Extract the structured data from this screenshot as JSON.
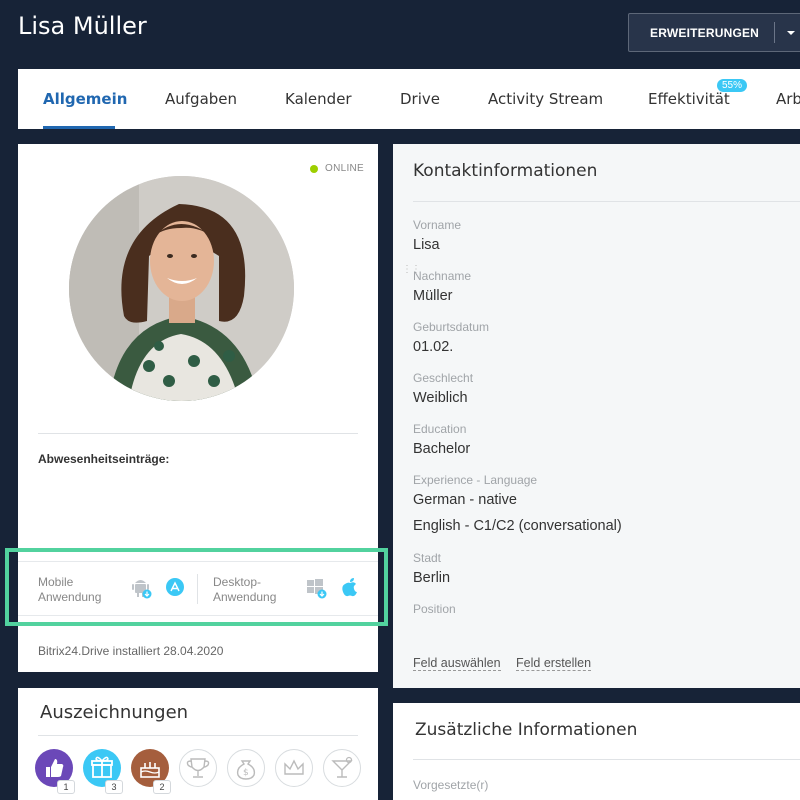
{
  "header": {
    "title": "Lisa Müller",
    "extensions_label": "ERWEITERUNGEN"
  },
  "tabs": [
    {
      "label": "Allgemein",
      "active": true
    },
    {
      "label": "Aufgaben"
    },
    {
      "label": "Kalender"
    },
    {
      "label": "Drive"
    },
    {
      "label": "Activity Stream"
    },
    {
      "label": "Effektivität",
      "badge": "55%"
    },
    {
      "label": "Arb"
    }
  ],
  "profile": {
    "status": "ONLINE",
    "absence_label": "Abwesenheitseinträge:",
    "apps": {
      "mobile_label_1": "Mobile",
      "mobile_label_2": "Anwendung",
      "desktop_label_1": "Desktop-",
      "desktop_label_2": "Anwendung",
      "icons": [
        "android-icon",
        "app-store-icon",
        "windows-icon",
        "apple-icon"
      ]
    },
    "drive_status": "Bitrix24.Drive installiert 28.04.2020"
  },
  "awards": {
    "title": "Auszeichnungen",
    "items": [
      {
        "icon": "thumbs-up-icon",
        "color": "#6b48b8",
        "count": "1"
      },
      {
        "icon": "gift-icon",
        "color": "#3bc8f5",
        "count": "3"
      },
      {
        "icon": "cake-icon",
        "color": "#a55e3d",
        "count": "2"
      },
      {
        "icon": "trophy-icon"
      },
      {
        "icon": "money-bag-icon"
      },
      {
        "icon": "crown-icon"
      },
      {
        "icon": "cocktail-icon"
      }
    ]
  },
  "contact": {
    "title": "Kontaktinformationen",
    "fields": [
      {
        "label": "Vorname",
        "value": "Lisa"
      },
      {
        "label": "Nachname",
        "value": "Müller"
      },
      {
        "label": "Geburtsdatum",
        "value": "01.02."
      },
      {
        "label": "Geschlecht",
        "value": "Weiblich"
      },
      {
        "label": "Education",
        "value": "Bachelor"
      },
      {
        "label": "Experience - Language",
        "value": "German - native",
        "value2": "English - C1/C2 (conversational)"
      },
      {
        "label": "Stadt",
        "value": "Berlin"
      },
      {
        "label": "Position",
        "value": ""
      }
    ],
    "link_select": "Feld auswählen",
    "link_create": "Feld erstellen"
  },
  "extra": {
    "title": "Zusätzliche Informationen",
    "field_label": "Vorgesetzte(r)"
  }
}
